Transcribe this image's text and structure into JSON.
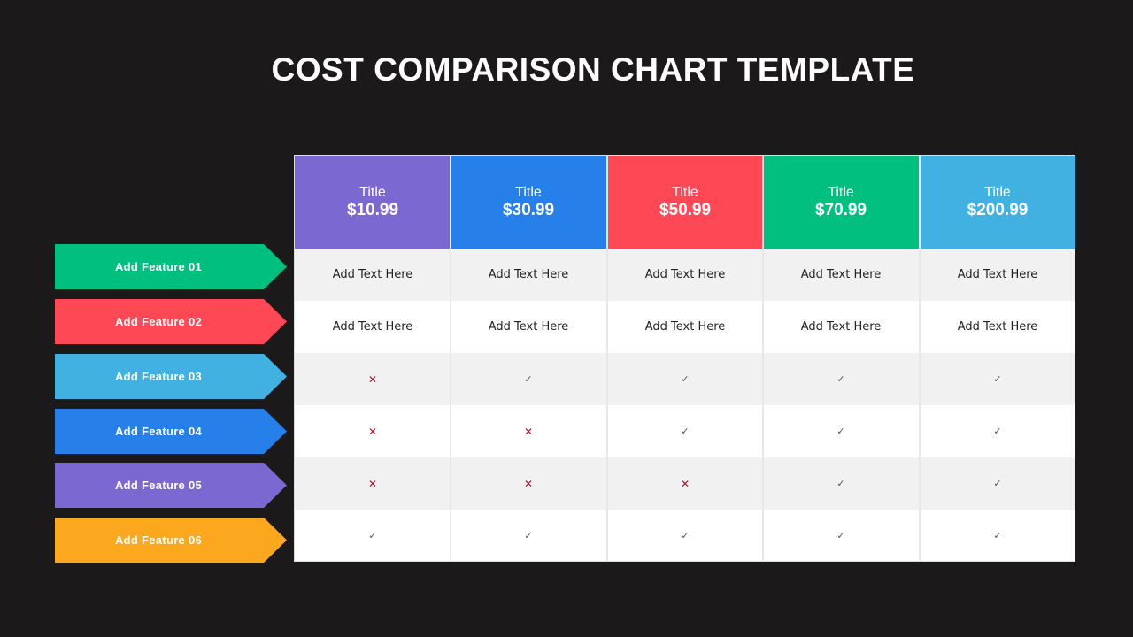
{
  "title": "COST COMPARISON CHART TEMPLATE",
  "features": [
    {
      "label": "Add Feature 01",
      "color": "#00bf7f"
    },
    {
      "label": "Add Feature 02",
      "color": "#ff4856"
    },
    {
      "label": "Add Feature 03",
      "color": "#40b1e0"
    },
    {
      "label": "Add Feature 04",
      "color": "#2780e9"
    },
    {
      "label": "Add Feature 05",
      "color": "#7b68d0"
    },
    {
      "label": "Add Feature 06",
      "color": "#fca81f"
    }
  ],
  "plans": [
    {
      "title": "Title",
      "price": "$10.99",
      "color": "#7b68d0"
    },
    {
      "title": "Title",
      "price": "$30.99",
      "color": "#2780e9"
    },
    {
      "title": "Title",
      "price": "$50.99",
      "color": "#ff4856"
    },
    {
      "title": "Title",
      "price": "$70.99",
      "color": "#00bf7f"
    },
    {
      "title": "Title",
      "price": "$200.99",
      "color": "#40b1e0"
    }
  ],
  "rows": [
    [
      "Add Text Here",
      "Add Text Here",
      "Add Text Here",
      "Add Text Here",
      "Add Text Here"
    ],
    [
      "Add Text Here",
      "Add Text Here",
      "Add Text Here",
      "Add Text Here",
      "Add Text Here"
    ],
    [
      "cross",
      "check",
      "check",
      "check",
      "check"
    ],
    [
      "cross",
      "cross",
      "check",
      "check",
      "check"
    ],
    [
      "cross",
      "cross",
      "cross",
      "check",
      "check"
    ],
    [
      "check",
      "check",
      "check",
      "check",
      "check"
    ]
  ],
  "icons": {
    "check": "✓",
    "cross": "✕"
  }
}
